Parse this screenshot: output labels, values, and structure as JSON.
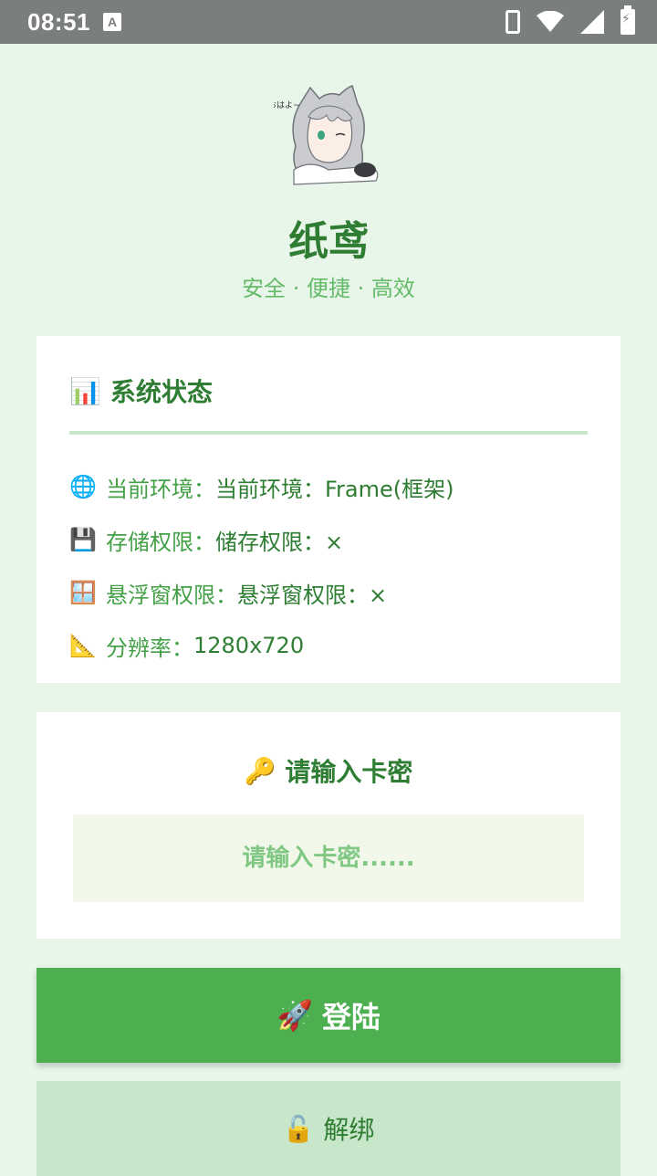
{
  "statusbar": {
    "time": "08:51",
    "notification_icon": "A"
  },
  "header": {
    "avatar_caption": "おはよ~",
    "title": "纸鸢",
    "subtitle": "安全 · 便捷 · 高效"
  },
  "status_card": {
    "title_emoji": "📊",
    "title": "系统状态",
    "rows": [
      {
        "icon": "🌐",
        "label": "当前环境：",
        "value": "当前环境：Frame(框架)"
      },
      {
        "icon": "💾",
        "label": "存储权限：",
        "value": "储存权限：×"
      },
      {
        "icon": "🪟",
        "label": "悬浮窗权限：",
        "value": "悬浮窗权限：×"
      },
      {
        "icon": "📐",
        "label": "分辨率：",
        "value": "1280x720"
      }
    ]
  },
  "key_card": {
    "title_emoji": "🔑",
    "title": "请输入卡密",
    "input_placeholder": "请输入卡密......",
    "input_value": ""
  },
  "buttons": {
    "login_emoji": "🚀",
    "login_label": "登陆",
    "unbind_emoji": "🔓",
    "unbind_label": "解绑"
  },
  "colors": {
    "background": "#e8f5e9",
    "primary": "#4caf50",
    "dark_green": "#2e7d32",
    "light_green": "#c8e6c9"
  }
}
